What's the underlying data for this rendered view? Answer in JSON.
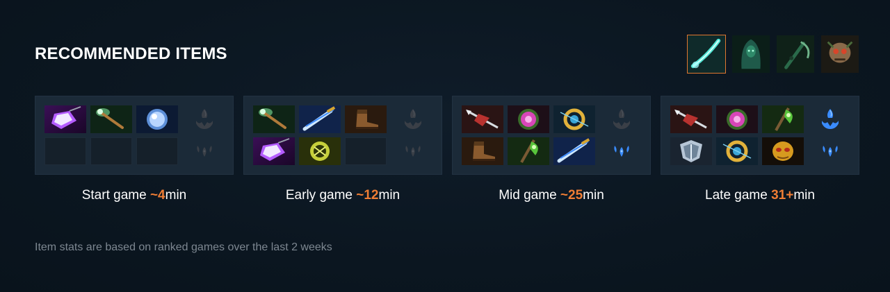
{
  "section": {
    "title": "RECOMMENDED ITEMS"
  },
  "build_variants": [
    {
      "icon": "glowing-blade-icon",
      "selected": true
    },
    {
      "icon": "hooded-hero-icon",
      "selected": false
    },
    {
      "icon": "scythe-hero-icon",
      "selected": false
    },
    {
      "icon": "skull-hero-icon",
      "selected": false
    }
  ],
  "phases": [
    {
      "name": "Start game",
      "time": "~4",
      "unit": "min",
      "items": [
        "purple-shard-icon",
        "green-wand-icon",
        "blue-orb-icon",
        "",
        "",
        ""
      ],
      "neutral_top_active": false,
      "neutral_bottom_active": false
    },
    {
      "name": "Early game",
      "time": "~12",
      "unit": "min",
      "items": [
        "green-wand-icon",
        "blue-dagger-icon",
        "boots-icon",
        "purple-shard-icon",
        "green-disc-icon",
        ""
      ],
      "neutral_top_active": false,
      "neutral_bottom_active": false
    },
    {
      "name": "Mid game",
      "time": "~25",
      "unit": "min",
      "items": [
        "red-spear-icon",
        "pink-orb-icon",
        "gold-ring-icon",
        "boots-icon",
        "green-axe-icon",
        "blue-dagger-icon"
      ],
      "neutral_top_active": false,
      "neutral_bottom_active": true
    },
    {
      "name": "Late game",
      "time": "31+",
      "unit": "min",
      "items": [
        "red-spear-icon",
        "pink-orb-icon",
        "green-axe-icon",
        "silver-shield-icon",
        "gold-ring-icon",
        "gold-mask-icon"
      ],
      "neutral_top_active": true,
      "neutral_bottom_active": true
    }
  ],
  "footnote": "Item stats are based on ranked games over the last 2 weeks",
  "colors": {
    "accent": "#ef7d34",
    "panel": "#1b2a38",
    "background": "#0b1620",
    "neutral_active": "#3a8cff",
    "neutral_inactive": "#3a3f47"
  }
}
